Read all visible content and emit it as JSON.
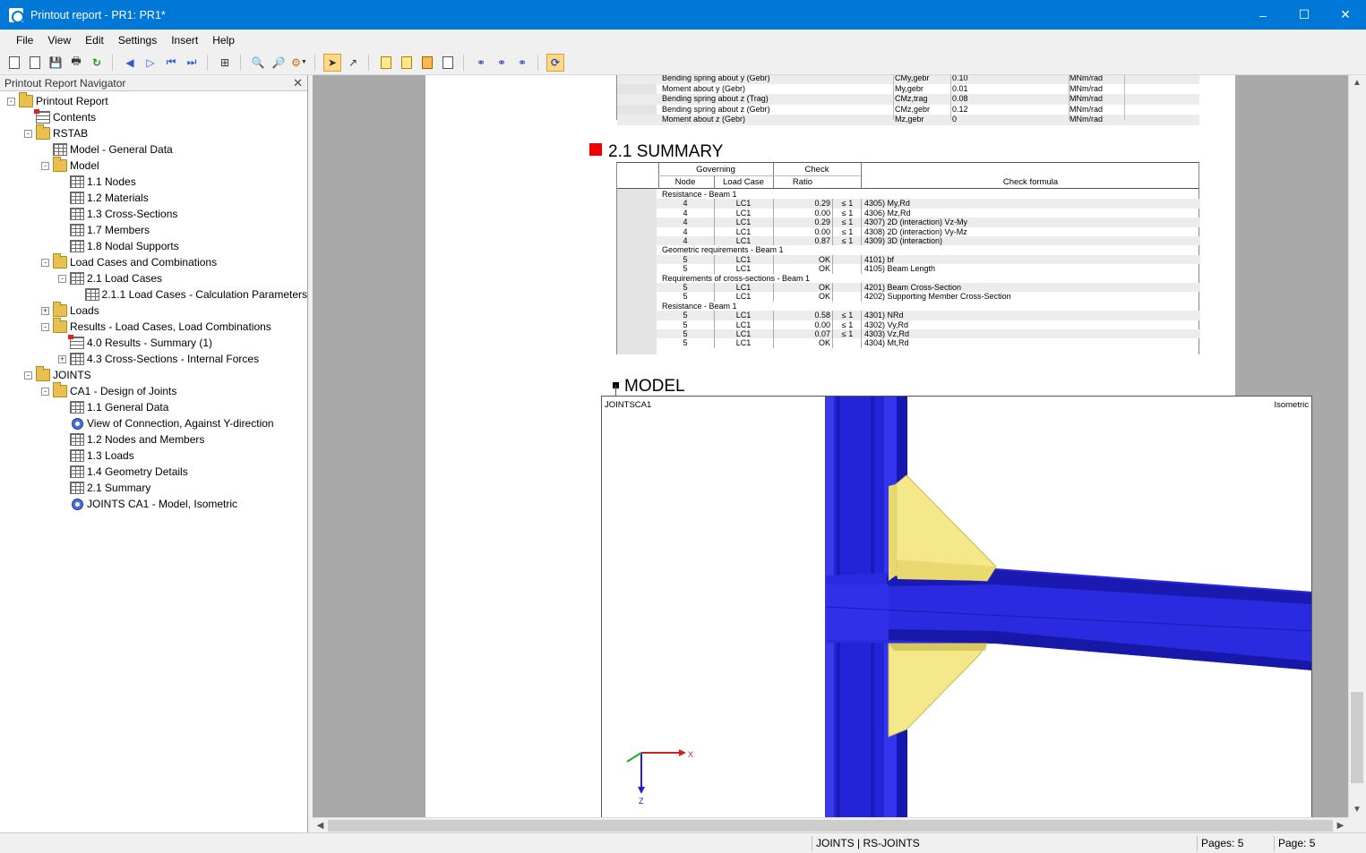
{
  "window": {
    "title": "Printout report - PR1: PR1*",
    "controls": [
      "minimize",
      "maximize",
      "close"
    ]
  },
  "menu": [
    "File",
    "View",
    "Edit",
    "Settings",
    "Insert",
    "Help"
  ],
  "navigator": {
    "title": "Printout Report Navigator",
    "items": [
      {
        "label": "Printout Report",
        "icon": "folder",
        "level": 0,
        "expander": "-"
      },
      {
        "label": "Contents",
        "icon": "tableflag",
        "level": 1,
        "expander": ""
      },
      {
        "label": "RSTAB",
        "icon": "folder",
        "level": 1,
        "expander": "-"
      },
      {
        "label": "Model - General Data",
        "icon": "table",
        "level": 2,
        "expander": ""
      },
      {
        "label": "Model",
        "icon": "folder",
        "level": 2,
        "expander": "-"
      },
      {
        "label": "1.1 Nodes",
        "icon": "table",
        "level": 3,
        "expander": ""
      },
      {
        "label": "1.2 Materials",
        "icon": "table",
        "level": 3,
        "expander": ""
      },
      {
        "label": "1.3 Cross-Sections",
        "icon": "table",
        "level": 3,
        "expander": ""
      },
      {
        "label": "1.7 Members",
        "icon": "table",
        "level": 3,
        "expander": ""
      },
      {
        "label": "1.8 Nodal Supports",
        "icon": "table",
        "level": 3,
        "expander": ""
      },
      {
        "label": "Load Cases and Combinations",
        "icon": "folder",
        "level": 2,
        "expander": "-"
      },
      {
        "label": "2.1 Load Cases",
        "icon": "table",
        "level": 3,
        "expander": "-"
      },
      {
        "label": "2.1.1 Load Cases - Calculation Parameters",
        "icon": "table",
        "level": 4,
        "expander": ""
      },
      {
        "label": "Loads",
        "icon": "folder",
        "level": 2,
        "expander": "+"
      },
      {
        "label": "Results - Load Cases, Load Combinations",
        "icon": "folder",
        "level": 2,
        "expander": "-"
      },
      {
        "label": "4.0 Results - Summary (1)",
        "icon": "tableflag",
        "level": 3,
        "expander": ""
      },
      {
        "label": "4.3 Cross-Sections - Internal Forces",
        "icon": "table",
        "level": 3,
        "expander": "+"
      },
      {
        "label": "JOINTS",
        "icon": "folder",
        "level": 1,
        "expander": "-"
      },
      {
        "label": "CA1 - Design of Joints",
        "icon": "folder",
        "level": 2,
        "expander": "-"
      },
      {
        "label": "1.1 General Data",
        "icon": "table",
        "level": 3,
        "expander": ""
      },
      {
        "label": "View of Connection, Against Y-direction",
        "icon": "eye",
        "level": 3,
        "expander": ""
      },
      {
        "label": "1.2 Nodes and Members",
        "icon": "table",
        "level": 3,
        "expander": ""
      },
      {
        "label": "1.3 Loads",
        "icon": "table",
        "level": 3,
        "expander": ""
      },
      {
        "label": "1.4 Geometry Details",
        "icon": "table",
        "level": 3,
        "expander": ""
      },
      {
        "label": "2.1 Summary",
        "icon": "table",
        "level": 3,
        "expander": ""
      },
      {
        "label": "JOINTS CA1 - Model, Isometric",
        "icon": "eye",
        "level": 3,
        "expander": ""
      }
    ]
  },
  "report": {
    "springs": [
      {
        "label": "Bending spring about y (Gebr)",
        "sym": "CMy,gebr",
        "val": "0.10",
        "unit": "MNm/rad"
      },
      {
        "label": "Moment about y (Gebr)",
        "sym": "My,gebr",
        "val": "0.01",
        "unit": "MNm/rad"
      },
      {
        "label": "Bending spring about z (Trag)",
        "sym": "CMz,trag",
        "val": "0.08",
        "unit": "MNm/rad"
      },
      {
        "label": "Bending spring about z (Gebr)",
        "sym": "CMz,gebr",
        "val": "0.12",
        "unit": "MNm/rad"
      },
      {
        "label": "Moment about z (Gebr)",
        "sym": "Mz,gebr",
        "val": "0",
        "unit": "MNm/rad"
      }
    ],
    "summary_heading": "2.1 SUMMARY",
    "summary_headers": {
      "governing": "Governing",
      "check": "Check",
      "node": "Node",
      "load_case": "Load Case",
      "ratio": "Ratio",
      "formula": "Check formula"
    },
    "summary_rows": [
      {
        "group": "Resistance - Beam 1"
      },
      {
        "node": "4",
        "lc": "LC1",
        "ratio": "0.29",
        "le": "≤ 1",
        "formula": "4305) My,Rd"
      },
      {
        "node": "4",
        "lc": "LC1",
        "ratio": "0.00",
        "le": "≤ 1",
        "formula": "4306) Mz,Rd"
      },
      {
        "node": "4",
        "lc": "LC1",
        "ratio": "0.29",
        "le": "≤ 1",
        "formula": "4307) 2D (interaction) Vz-My"
      },
      {
        "node": "4",
        "lc": "LC1",
        "ratio": "0.00",
        "le": "≤ 1",
        "formula": "4308) 2D (interaction) Vy-Mz"
      },
      {
        "node": "4",
        "lc": "LC1",
        "ratio": "0.87",
        "le": "≤ 1",
        "formula": "4309) 3D (interaction)"
      },
      {
        "group": "Geometric requirements - Beam 1"
      },
      {
        "node": "5",
        "lc": "LC1",
        "ratio": "OK",
        "le": "",
        "formula": "4101) bf"
      },
      {
        "node": "5",
        "lc": "LC1",
        "ratio": "OK",
        "le": "",
        "formula": "4105) Beam Length"
      },
      {
        "group": "Requirements of cross-sections - Beam 1"
      },
      {
        "node": "5",
        "lc": "LC1",
        "ratio": "OK",
        "le": "",
        "formula": "4201) Beam Cross-Section"
      },
      {
        "node": "5",
        "lc": "LC1",
        "ratio": "OK",
        "le": "",
        "formula": "4202) Supporting Member Cross-Section"
      },
      {
        "group": "Resistance - Beam 1"
      },
      {
        "node": "5",
        "lc": "LC1",
        "ratio": "0.58",
        "le": "≤ 1",
        "formula": "4301) NRd"
      },
      {
        "node": "5",
        "lc": "LC1",
        "ratio": "0.00",
        "le": "≤ 1",
        "formula": "4302) Vy,Rd"
      },
      {
        "node": "5",
        "lc": "LC1",
        "ratio": "0.07",
        "le": "≤ 1",
        "formula": "4303) Vz,Rd"
      },
      {
        "node": "5",
        "lc": "LC1",
        "ratio": "OK",
        "le": "",
        "formula": "4304) Mt,Rd"
      }
    ],
    "model_heading": "MODEL",
    "model_label_left": "JOINTSCA1",
    "model_label_right": "Isometric",
    "axis_x": "X",
    "axis_z": "Z"
  },
  "status": {
    "module": "JOINTS | RS-JOINTS",
    "pages": "Pages: 5",
    "page": "Page: 5"
  },
  "colors": {
    "titlebar": "#0078d7",
    "marker": "#ee0000",
    "column": "#2a2ae0",
    "plate": "#f5e88a"
  }
}
